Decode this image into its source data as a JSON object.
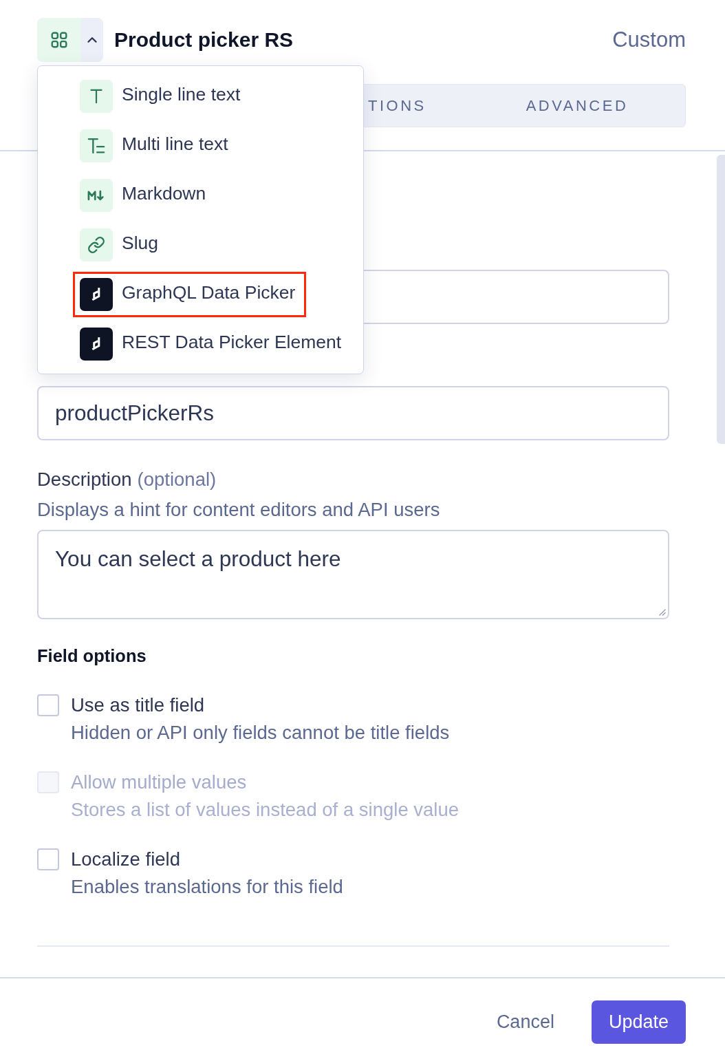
{
  "header": {
    "title": "Product picker RS",
    "type_label": "Custom"
  },
  "tabs": [
    {
      "label": "TIONS",
      "selected": false
    },
    {
      "label": "ADVANCED",
      "selected": false
    }
  ],
  "field_type_menu": {
    "expanded": true,
    "items": [
      {
        "kind": "text",
        "label": "Single line text",
        "highlighted": false
      },
      {
        "kind": "multiline",
        "label": "Multi line text",
        "highlighted": false
      },
      {
        "kind": "markdown",
        "label": "Markdown",
        "highlighted": false
      },
      {
        "kind": "slug",
        "label": "Slug",
        "highlighted": false
      },
      {
        "kind": "app",
        "label": "GraphQL Data Picker",
        "highlighted": true
      },
      {
        "kind": "app",
        "label": "REST Data Picker Element",
        "highlighted": false
      }
    ]
  },
  "fields": [
    {
      "kind": "input"
    },
    {
      "kind": "input",
      "value": "productPickerRs"
    },
    {
      "kind": "textarea",
      "label": "Description",
      "optional": "(optional)",
      "hint": "Displays a hint for content editors and API users",
      "value": "You can select a product here"
    }
  ],
  "field_options": {
    "title": "Field options",
    "items": [
      {
        "label": "Use as title field",
        "hint": "Hidden or API only fields cannot be title fields",
        "checked": false,
        "disabled": false
      },
      {
        "label": "Allow multiple values",
        "hint": "Stores a list of values instead of a single value",
        "checked": false,
        "disabled": true
      },
      {
        "label": "Localize field",
        "hint": "Enables translations for this field",
        "checked": false,
        "disabled": false
      }
    ]
  },
  "actions": [
    {
      "kind": "secondary",
      "label": "Cancel"
    },
    {
      "kind": "primary",
      "label": "Update"
    }
  ]
}
